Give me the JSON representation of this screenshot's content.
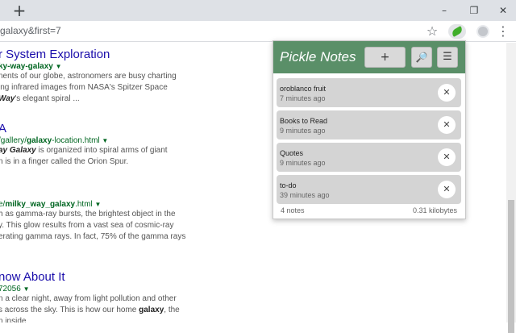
{
  "tabstrip": {
    "new_tab": "+",
    "minimize": "–",
    "restore": "❐",
    "close": "✕"
  },
  "toolbar": {
    "url": "galaxy&first=7",
    "star": "☆",
    "menu": "⋮"
  },
  "results": [
    {
      "title": "r System Exploration",
      "url_bold": "ky-way-galaxy",
      "url_rest": "",
      "snippet": [
        [
          "nents of our globe, astronomers are busy charting"
        ],
        [
          "ing infrared images from NASA's Spitzer Space"
        ],
        [
          "Way's elegant spiral ..."
        ]
      ]
    }
  ],
  "result_texts": {
    "r1_title": "r System Exploration",
    "r1_url": "ky-way-galaxy",
    "r1_l1": "nents of our globe, astronomers are busy charting",
    "r1_l2": "ing infrared images from NASA's Spitzer Space",
    "r1_l3_bold": "Way",
    "r1_l3_rest": "'s elegant spiral ...",
    "r2_title": "A",
    "r2_url_a": "/gallery/",
    "r2_url_b": "galaxy",
    "r2_url_c": "-location.html",
    "r2_l1_bold": "ay Galaxy",
    "r2_l1_rest": " is organized into spiral arms of giant",
    "r2_l2": "n is in a finger called the Orion Spur.",
    "r3_url_a": "e/",
    "r3_url_b": "milky_way_galaxy",
    "r3_url_c": ".html",
    "r3_l1": "h as gamma-ray bursts, the brightest object in the",
    "r3_l2": "y. This glow results from a vast sea of cosmic-ray",
    "r3_l3": "erating gamma rays. In fact, 75% of the gamma rays",
    "r4_title": "now About It",
    "r4_url": "72056",
    "r4_l1": "n a clear night, away from light pollution and other",
    "r4_l2": "s across the sky. This is how our home ",
    "r4_l2_bold": "galaxy",
    "r4_l2_rest": ", the",
    "r4_l3": "n inside"
  },
  "popup": {
    "title": "Pickle Notes",
    "add_label": "+",
    "search_icon": "🔎",
    "menu_icon": "☰",
    "notes": [
      {
        "title": "oroblanco fruit",
        "time": "7 minutes ago"
      },
      {
        "title": "Books to Read",
        "time": "9 minutes ago"
      },
      {
        "title": "Quotes",
        "time": "9 minutes ago"
      },
      {
        "title": "to-do",
        "time": "39 minutes ago"
      }
    ],
    "delete_icon": "✕",
    "count": "4 notes",
    "size": "0.31 kilobytes"
  },
  "colors": {
    "header": "#5a8f68",
    "link": "#1a0dab",
    "url": "#006621",
    "note_bg": "#d4d4d4"
  }
}
